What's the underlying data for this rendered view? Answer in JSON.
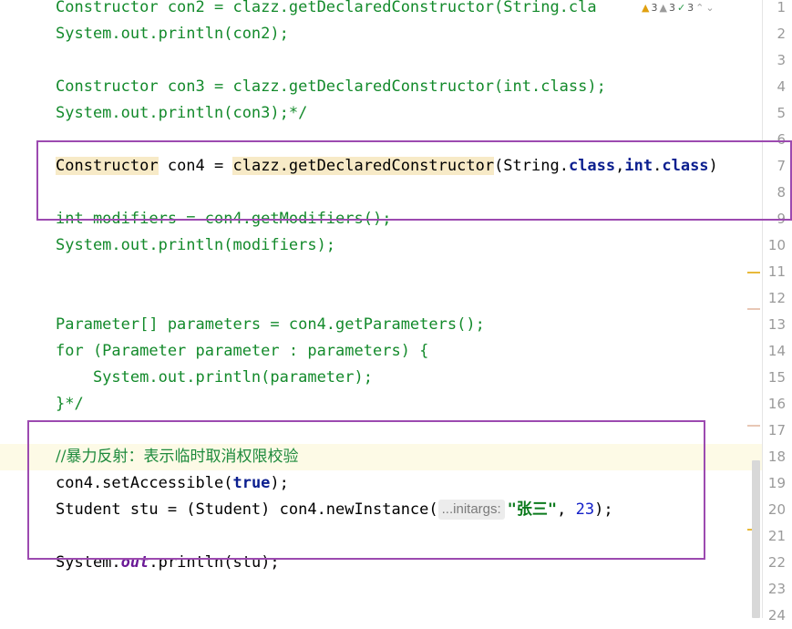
{
  "inspection": {
    "warnings_count": "3",
    "weak_warnings_count": "3",
    "ok_count": "3"
  },
  "code": [
    {
      "n": "1",
      "text": "Constructor con2 = clazz.getDeclaredConstructor(String.cla"
    },
    {
      "n": "2",
      "text": "System.out.println(con2);"
    },
    {
      "n": "3",
      "text": ""
    },
    {
      "n": "4",
      "text": "Constructor con3 = clazz.getDeclaredConstructor(int.class);"
    },
    {
      "n": "5",
      "text": "System.out.println(con3);*/"
    },
    {
      "n": "6",
      "text": ""
    },
    {
      "n": "7",
      "a": "Constructor",
      "b": " con4 = ",
      "c": "clazz.getDeclaredConstructor",
      "d": "(String.",
      "e": "class",
      "f": ",",
      "g": "int",
      "h": ".",
      "i": "class",
      "j": ")"
    },
    {
      "n": "8",
      "text": ""
    },
    {
      "n": "9",
      "text": "int modifiers = con4.getModifiers();"
    },
    {
      "n": "10",
      "text": "System.out.println(modifiers);"
    },
    {
      "n": "11",
      "text": ""
    },
    {
      "n": "12",
      "text": ""
    },
    {
      "n": "13",
      "text": "Parameter[] parameters = con4.getParameters();"
    },
    {
      "n": "14",
      "text": "for (Parameter parameter : parameters) {"
    },
    {
      "n": "15",
      "text": "    System.out.println(parameter);"
    },
    {
      "n": "16",
      "text": "}*/"
    },
    {
      "n": "17",
      "text": ""
    },
    {
      "n": "18",
      "text": "//暴力反射：表示临时取消权限校验"
    },
    {
      "n": "19",
      "a": "con4.setAccessible(",
      "b": "true",
      "c": ");"
    },
    {
      "n": "20",
      "a": "Student stu = (Student) con4.newInstance(",
      "hint": "...initargs:",
      "b": "\"张三\"",
      "c": ", ",
      "d": "23",
      "e": ");"
    },
    {
      "n": "21",
      "text": ""
    },
    {
      "n": "22",
      "a": "System.",
      "b": "out",
      "c": ".println(stu);"
    },
    {
      "n": "23",
      "text": ""
    },
    {
      "n": "24",
      "text": ""
    }
  ],
  "colors": {
    "comment": "#138a2b",
    "keyword": "#0b1f8f",
    "string": "#0b7a1c",
    "number": "#1420c8",
    "static_field": "#6a1a96",
    "highlight_box": "#9c4ab0",
    "current_line": "#fdfae6"
  }
}
